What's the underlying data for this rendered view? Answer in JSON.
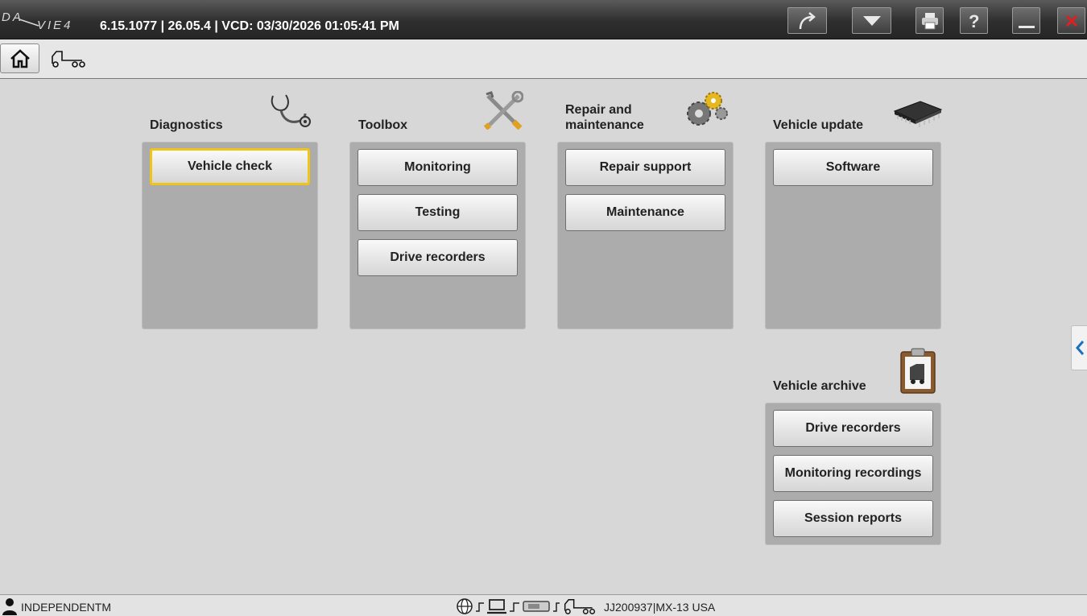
{
  "titlebar": {
    "logo_text": "DAVIE4",
    "version_info": "6.15.1077 | 26.05.4 | VCD: 03/30/2026 01:05:41 PM",
    "buttons": [
      "redo-icon",
      "dropdown-icon",
      "print-icon",
      "help-icon",
      "minimize-icon",
      "close-icon"
    ]
  },
  "toolbar": {
    "home_icon": "home-icon",
    "vehicle_icon": "truck-icon"
  },
  "groups": {
    "diagnostics": {
      "title": "Diagnostics",
      "icon": "stethoscope-icon",
      "buttons": [
        "Vehicle check"
      ]
    },
    "toolbox": {
      "title": "Toolbox",
      "icon": "tools-icon",
      "buttons": [
        "Monitoring",
        "Testing",
        "Drive recorders"
      ]
    },
    "repair": {
      "title_line1": "Repair and",
      "title_line2": "maintenance",
      "icon": "gears-icon",
      "buttons": [
        "Repair support",
        "Maintenance"
      ]
    },
    "update": {
      "title": "Vehicle update",
      "icon": "chip-icon",
      "buttons": [
        "Software"
      ]
    },
    "archive": {
      "title": "Vehicle archive",
      "icon": "clipboard-icon",
      "buttons": [
        "Drive recorders",
        "Monitoring recordings",
        "Session reports"
      ]
    }
  },
  "side_tab": {
    "icon": "chevron-left-icon"
  },
  "statusbar": {
    "user": "INDEPENDENTM",
    "vehicle": "JJ200937|MX-13 USA",
    "connection_icons": [
      "globe-icon",
      "laptop-icon",
      "vci-icon",
      "truck-icon"
    ]
  },
  "colors": {
    "focus": "#f0c419",
    "accent_blue": "#1e6fc0",
    "close_red": "#e02020"
  }
}
